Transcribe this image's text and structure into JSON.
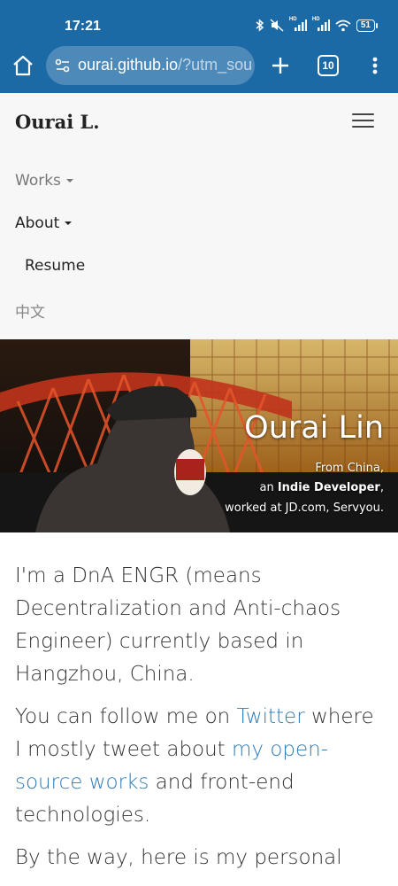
{
  "status_bar": {
    "time": "17:21",
    "battery": "51",
    "icons": [
      "bluetooth-icon",
      "mute-icon",
      "signal-icon",
      "signal-icon",
      "wifi-icon",
      "battery-icon"
    ],
    "hd1": "HD",
    "hd2": "HD"
  },
  "browser": {
    "url_host": "ourai.github.io",
    "url_rest": "/?utm_sou",
    "tab_count": "10",
    "chrome_color": "#1b6aa6"
  },
  "site_nav": {
    "brand": "Ourai L.",
    "items": [
      {
        "label": "Works"
      },
      {
        "label": "About"
      },
      {
        "label": "Resume"
      },
      {
        "label": "中文"
      }
    ]
  },
  "hero": {
    "title": "Ourai Lin",
    "line1": "From China,",
    "line2_prefix": "an ",
    "line2_bold": "Indie Developer",
    "line2_suffix": ",",
    "line3": "worked at JD.com, Servyou."
  },
  "content": {
    "p1": "I'm a DnA ENGR (means Decentralization and Anti-chaos Engineer) currently based in Hangzhou, China.",
    "p2_a": "You can follow me on ",
    "p2_link1": "Twitter",
    "p2_b": " where I mostly tweet about ",
    "p2_link2": "my open-source works",
    "p2_c": " and front-end technologies.",
    "p3": "By the way, here is my personal",
    "link_color": "#2f7ab3"
  }
}
